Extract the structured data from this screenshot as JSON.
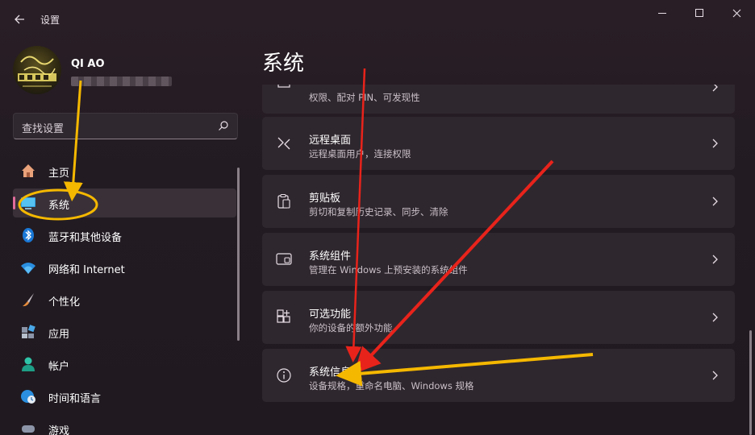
{
  "window": {
    "app_title": "设置",
    "back_icon": "back-arrow-icon",
    "controls": [
      "minimize-icon",
      "maximize-icon",
      "close-icon"
    ]
  },
  "user": {
    "name": "QI AO"
  },
  "search": {
    "placeholder": "查找设置",
    "icon": "search-icon"
  },
  "sidebar": {
    "items": [
      {
        "label": "主页",
        "icon": "home-icon"
      },
      {
        "label": "系统",
        "icon": "system-display-icon",
        "active": true
      },
      {
        "label": "蓝牙和其他设备",
        "icon": "bluetooth-icon"
      },
      {
        "label": "网络和 Internet",
        "icon": "wifi-icon"
      },
      {
        "label": "个性化",
        "icon": "brush-icon"
      },
      {
        "label": "应用",
        "icon": "apps-icon"
      },
      {
        "label": "帐户",
        "icon": "account-icon"
      },
      {
        "label": "时间和语言",
        "icon": "globe-clock-icon"
      },
      {
        "label": "游戏",
        "icon": "gamepad-icon"
      }
    ]
  },
  "main": {
    "title": "系统",
    "cards": [
      {
        "title": "",
        "subtitle": "权限、配对 PIN、可发现性",
        "icon": "projection-icon"
      },
      {
        "title": "远程桌面",
        "subtitle": "远程桌面用户，连接权限",
        "icon": "remote-desktop-icon"
      },
      {
        "title": "剪贴板",
        "subtitle": "剪切和复制历史记录、同步、清除",
        "icon": "clipboard-icon"
      },
      {
        "title": "系统组件",
        "subtitle": "管理在 Windows 上预安装的系统组件",
        "icon": "system-components-icon"
      },
      {
        "title": "可选功能",
        "subtitle": "你的设备的额外功能",
        "icon": "optional-features-icon"
      },
      {
        "title": "系统信息",
        "subtitle": "设备规格，重命名电脑、Windows 规格",
        "icon": "info-icon"
      }
    ]
  },
  "colors": {
    "accent": "#e06c9c",
    "annotation_yellow": "#f5b800",
    "annotation_red": "#e8231b"
  }
}
